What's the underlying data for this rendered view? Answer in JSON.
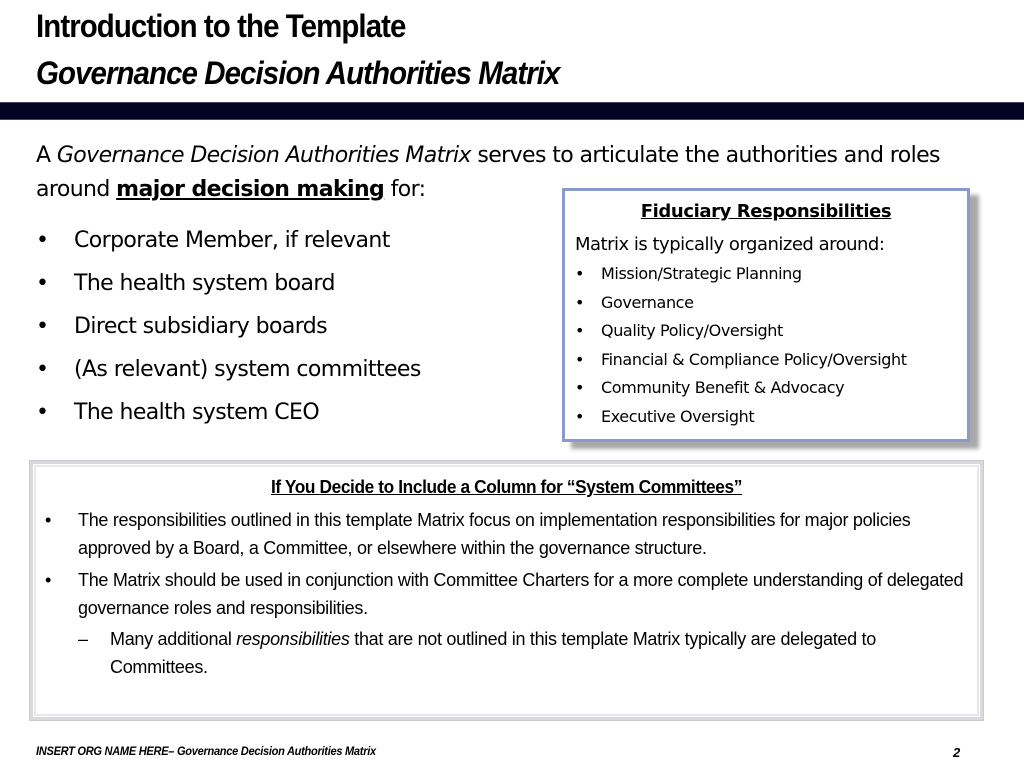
{
  "header": {
    "title": "Introduction to the Template",
    "subtitle": "Governance Decision Authorities Matrix",
    "bar_color": "#020224"
  },
  "intro": {
    "prefix": "A ",
    "italic_term": "Governance Decision Authorities Matrix",
    "middle": " serves to articulate the authorities and roles around ",
    "emphasis": "major decision making",
    "suffix": " for:"
  },
  "main_list": {
    "bullet_glyph": "•",
    "items": [
      "Corporate Member, if relevant",
      "The health system board",
      "Direct subsidiary boards",
      "(As relevant) system committees",
      "The health system CEO"
    ]
  },
  "fiduciary_box": {
    "title": "Fiduciary Responsibilities",
    "intro": "Matrix is typically organized around:",
    "border_color": "#8a9ad0",
    "items": [
      "Mission/Strategic Planning",
      "Governance",
      "Quality Policy/Oversight",
      "Financial & Compliance Policy/Oversight",
      "Community Benefit & Advocacy",
      "Executive Oversight"
    ]
  },
  "system_committees_box": {
    "title": "If You Decide to Include a Column for “System Committees”",
    "bullets": [
      "The responsibilities outlined in this template Matrix focus on implementation responsibilities for major policies approved by a Board, a Committee, or elsewhere within the governance structure.",
      "The Matrix should be used in conjunction with Committee Charters for a more complete understanding of delegated governance roles and responsibilities."
    ],
    "sub_bullet": {
      "dash_glyph": "–",
      "prefix": "Many additional ",
      "italic": "responsibilities",
      "suffix": " that are not outlined in this template Matrix typically are delegated to Committees."
    }
  },
  "footer": {
    "left_text": "INSERT ORG NAME HERE– Governance Decision Authorities Matrix",
    "page_number": "2"
  }
}
